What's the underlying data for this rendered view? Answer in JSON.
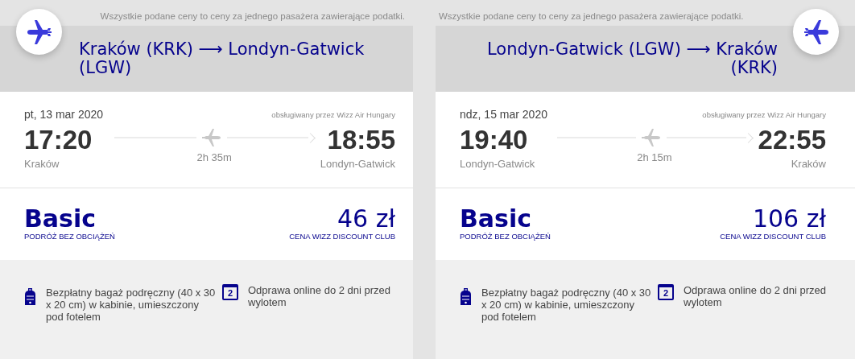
{
  "flights": [
    {
      "kind": "outbound",
      "note": "Wszystkie podane ceny to ceny za jednego pasażera zawierające podatki.",
      "route": "Kraków (KRK) ⟶ Londyn-Gatwick (LGW)",
      "date": "pt, 13 mar 2020",
      "operator": "obsługiwany przez Wizz Air Hungary",
      "departure_time": "17:20",
      "departure_city": "Kraków",
      "duration": "2h 35m",
      "arrival_time": "18:55",
      "arrival_city": "Londyn-Gatwick",
      "fare": "Basic",
      "fare_subtitle": "PODRÓŻ BEZ OBCIĄŻEŃ",
      "price": "46 zł",
      "price_label": "CENA WIZZ DISCOUNT CLUB",
      "features": [
        {
          "kind": "bag",
          "text": "Bezpłatny bagaż podręczny (40 x 30 x 20 cm) w kabinie, umieszczony pod fotelem"
        },
        {
          "kind": "calendar",
          "icon_text": "2",
          "text": "Odprawa online do 2 dni przed wylotem"
        }
      ]
    },
    {
      "kind": "inbound",
      "note": "Wszystkie podane ceny to ceny za jednego pasażera zawierające podatki.",
      "route": "Londyn-Gatwick (LGW) ⟶ Kraków (KRK)",
      "date": "ndz, 15 mar 2020",
      "operator": "obsługiwany przez Wizz Air Hungary",
      "departure_time": "19:40",
      "departure_city": "Londyn-Gatwick",
      "duration": "2h 15m",
      "arrival_time": "22:55",
      "arrival_city": "Kraków",
      "fare": "Basic",
      "fare_subtitle": "PODRÓŻ BEZ OBCIĄŻEŃ",
      "price": "106 zł",
      "price_label": "CENA WIZZ DISCOUNT CLUB",
      "features": [
        {
          "kind": "bag",
          "text": "Bezpłatny bagaż podręczny (40 x 30 x 20 cm) w kabinie, umieszczony pod fotelem"
        },
        {
          "kind": "calendar",
          "icon_text": "2",
          "text": "Odprawa online do 2 dni przed wylotem"
        }
      ]
    }
  ]
}
